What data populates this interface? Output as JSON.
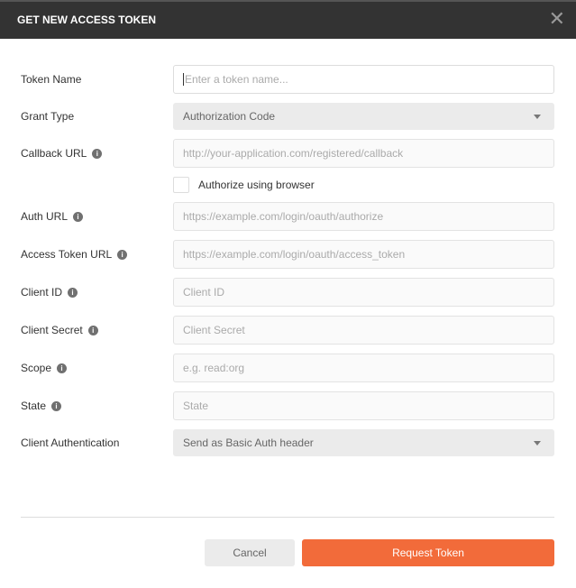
{
  "dialog": {
    "title": "GET NEW ACCESS TOKEN",
    "close_icon": "close-icon"
  },
  "fields": {
    "token_name": {
      "label": "Token Name",
      "placeholder": "Enter a token name..."
    },
    "grant_type": {
      "label": "Grant Type",
      "value": "Authorization Code"
    },
    "callback_url": {
      "label": "Callback URL",
      "placeholder": "http://your-application.com/registered/callback"
    },
    "authorize_browser": {
      "label": "Authorize using browser",
      "checked": false
    },
    "auth_url": {
      "label": "Auth URL",
      "placeholder": "https://example.com/login/oauth/authorize"
    },
    "access_token_url": {
      "label": "Access Token URL",
      "placeholder": "https://example.com/login/oauth/access_token"
    },
    "client_id": {
      "label": "Client ID",
      "placeholder": "Client ID"
    },
    "client_secret": {
      "label": "Client Secret",
      "placeholder": "Client Secret"
    },
    "scope": {
      "label": "Scope",
      "placeholder": "e.g. read:org"
    },
    "state": {
      "label": "State",
      "placeholder": "State"
    },
    "client_auth": {
      "label": "Client Authentication",
      "value": "Send as Basic Auth header"
    }
  },
  "info_glyph": "i",
  "buttons": {
    "cancel": "Cancel",
    "request": "Request Token"
  },
  "colors": {
    "accent": "#f26b3a",
    "header": "#333333"
  }
}
